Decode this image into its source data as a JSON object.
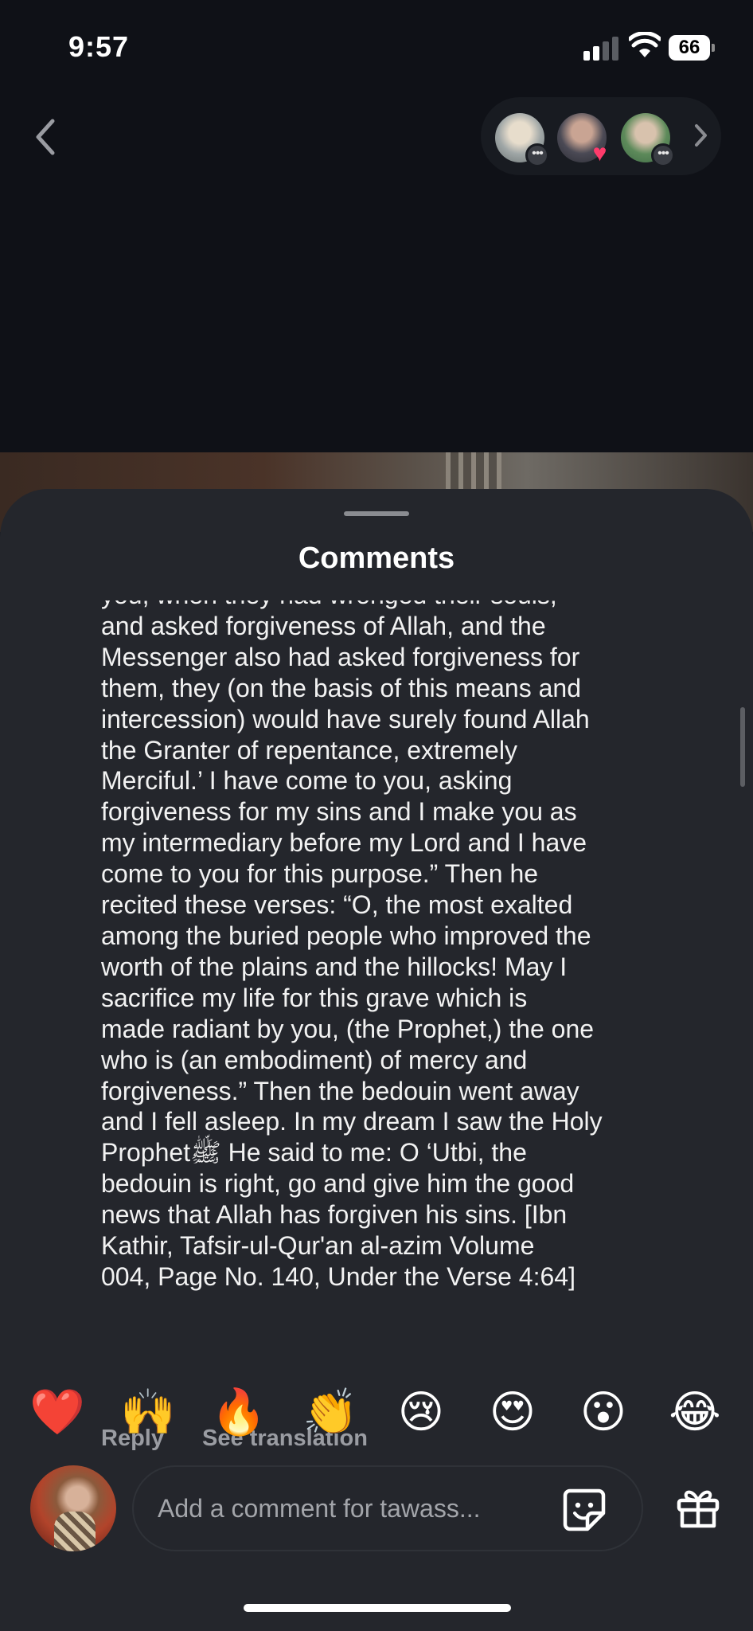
{
  "status_bar": {
    "time": "9:57",
    "battery": "66",
    "icons": [
      "signal-icon",
      "wifi-icon",
      "battery-icon"
    ]
  },
  "nav": {
    "back_icon": "chevron-left-icon",
    "viewers_next_icon": "chevron-right-icon",
    "viewer_badges": [
      "•••",
      "♥",
      "•••"
    ]
  },
  "sheet": {
    "title": "Comments"
  },
  "comment": {
    "text": "you, when they had wronged their souls,\nand asked forgiveness of Allah, and the\nMessenger also had asked forgiveness for\nthem, they (on the basis of this means and\nintercession) would have surely found Allah\nthe Granter of repentance, extremely\nMerciful.’ I have come to you, asking\nforgiveness for my sins and I make you as\nmy intermediary before my Lord and I have\ncome to you for this purpose.” Then he\nrecited these verses: “O, the most exalted\namong the buried people who improved the\nworth of the plains and the hillocks! May I\nsacrifice my life for this grave which is\nmade radiant by you, (the Prophet,) the one\nwho is (an embodiment) of mercy and\nforgiveness.” Then the bedouin went away\nand I fell asleep. In my dream I saw the Holy\nProphetﷺ He said to me: O ‘Utbi, the\nbedouin is right, go and give him the good\nnews that Allah has forgiven his sins. [Ibn\nKathir, Tafsir-ul-Qur'an al-azim Volume\n004, Page No. 140, Under the Verse 4:64]",
    "reply_label": "Reply",
    "translate_label": "See translation"
  },
  "emoji_bar": [
    "❤️",
    "🙌",
    "🔥",
    "👏",
    "😢",
    "😍",
    "😮",
    "😂"
  ],
  "composer": {
    "placeholder": "Add a comment for tawass...",
    "sticker_icon": "sticker-icon",
    "gift_icon": "gift-icon"
  }
}
